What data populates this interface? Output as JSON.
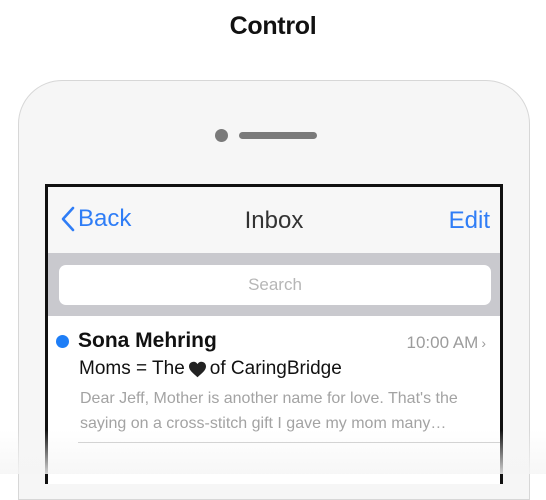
{
  "caption": "Control",
  "nav": {
    "back_label": "Back",
    "title": "Inbox",
    "edit_label": "Edit"
  },
  "search": {
    "placeholder": "Search"
  },
  "messages": [
    {
      "sender": "Sona Mehring",
      "time": "10:00 AM",
      "subject_before": "Moms = The",
      "subject_after": "of CaringBridge",
      "preview_line1": "Dear Jeff, Mother is another name for love. That's the",
      "preview_line2": "saying on a cross-stitch gift I gave my mom many…",
      "unread": true
    }
  ],
  "colors": {
    "accent": "#2f7df6",
    "unread": "#1e7ef7"
  },
  "icons": {
    "back": "chevron-left-icon",
    "heart": "heart-icon",
    "disclosure": "chevron-right-icon"
  }
}
